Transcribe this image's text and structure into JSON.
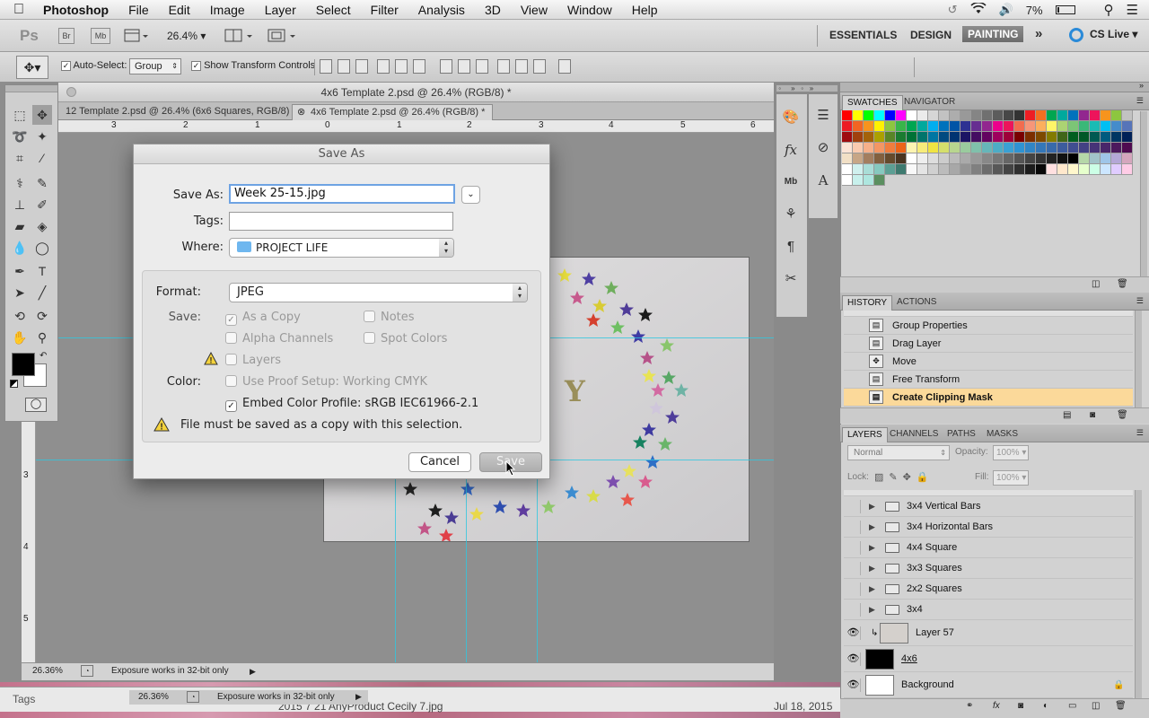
{
  "menubar": {
    "app_name": "Photoshop",
    "items": [
      "File",
      "Edit",
      "Image",
      "Layer",
      "Select",
      "Filter",
      "Analysis",
      "3D",
      "View",
      "Window",
      "Help"
    ],
    "battery": "7%"
  },
  "appbar": {
    "logo": "Ps",
    "bridge": "Br",
    "minibridge": "Mb",
    "zoom": "26.4%",
    "workspaces": [
      "ESSENTIALS",
      "DESIGN",
      "PAINTING"
    ],
    "active_workspace": "PAINTING",
    "more": "»",
    "cslive": "CS Live"
  },
  "options_bar": {
    "auto_select_label": "Auto-Select:",
    "auto_select_checked": true,
    "auto_select_value": "Group",
    "show_transform_label": "Show Transform Controls",
    "show_transform_checked": true
  },
  "document": {
    "window_title": "4x6 Template 2.psd @ 26.4% (RGB/8) *",
    "tabs": [
      {
        "label": "12 Template 2.psd @ 26.4% (6x6 Squares, RGB/8)",
        "active": false
      },
      {
        "label": "4x6 Template 2.psd @ 26.4% (RGB/8) *",
        "active": true
      }
    ],
    "ruler_top": [
      "3",
      "2",
      "1",
      "0",
      "1",
      "2",
      "3",
      "4",
      "5",
      "6"
    ],
    "ruler_left": [
      "3",
      "4",
      "5"
    ],
    "canvas_letter": "Y",
    "status_zoom": "26.36%",
    "status_text": "Exposure works in 32-bit only"
  },
  "background_window": {
    "status_zoom": "26.36%",
    "status_text": "Exposure works in 32-bit only",
    "finder_label": "Tags",
    "finder_file": "2015 7 21 AnyProduct Cecily 7.jpg",
    "finder_date": "Jul 18, 2015"
  },
  "save_dialog": {
    "title": "Save As",
    "save_as_label": "Save As:",
    "filename": "Week 25-15.jpg",
    "tags_label": "Tags:",
    "tags_value": "",
    "where_label": "Where:",
    "where_value": "PROJECT LIFE",
    "format_label": "Format:",
    "format_value": "JPEG",
    "save_label": "Save:",
    "color_label": "Color:",
    "options": {
      "as_a_copy": {
        "label": "As a Copy",
        "checked": true,
        "enabled": false
      },
      "notes": {
        "label": "Notes",
        "checked": false,
        "enabled": false
      },
      "alpha_channels": {
        "label": "Alpha Channels",
        "checked": false,
        "enabled": false
      },
      "spot_colors": {
        "label": "Spot Colors",
        "checked": false,
        "enabled": false
      },
      "layers": {
        "label": "Layers",
        "checked": false,
        "enabled": false
      },
      "use_proof_setup": {
        "label": "Use Proof Setup:  Working CMYK",
        "checked": false,
        "enabled": false
      },
      "embed_color_profile": {
        "label": "Embed Color Profile:  sRGB IEC61966-2.1",
        "checked": true,
        "enabled": true
      }
    },
    "warning": "File must be saved as a copy with this selection.",
    "cancel_label": "Cancel",
    "save_button_label": "Save"
  },
  "swatches_panel": {
    "tabs": [
      "SWATCHES",
      "NAVIGATOR"
    ],
    "active_tab": "SWATCHES"
  },
  "history_panel": {
    "tabs": [
      "HISTORY",
      "ACTIONS"
    ],
    "active_tab": "HISTORY",
    "items": [
      {
        "label": "Group Properties",
        "selected": false
      },
      {
        "label": "Drag Layer",
        "selected": false
      },
      {
        "label": "Move",
        "selected": false
      },
      {
        "label": "Free Transform",
        "selected": false
      },
      {
        "label": "Create Clipping Mask",
        "selected": true
      }
    ]
  },
  "layers_panel": {
    "tabs": [
      "LAYERS",
      "CHANNELS",
      "PATHS",
      "MASKS"
    ],
    "active_tab": "LAYERS",
    "blend_mode": "Normal",
    "opacity_label": "Opacity:",
    "opacity_value": "100%",
    "lock_label": "Lock:",
    "fill_label": "Fill:",
    "fill_value": "100%",
    "layers": [
      {
        "name": "3x4 Vertical Bars",
        "type": "group",
        "visible": false
      },
      {
        "name": "3x4 Horizontal Bars",
        "type": "group",
        "visible": false
      },
      {
        "name": "4x4 Square",
        "type": "group",
        "visible": false
      },
      {
        "name": "3x3 Squares",
        "type": "group",
        "visible": false
      },
      {
        "name": "2x2 Squares",
        "type": "group",
        "visible": false
      },
      {
        "name": "3x4",
        "type": "group",
        "visible": false
      },
      {
        "name": "Layer 57",
        "type": "image",
        "visible": true
      },
      {
        "name": "4x6",
        "type": "shape",
        "visible": true
      },
      {
        "name": "Background",
        "type": "background",
        "visible": true
      }
    ]
  },
  "colors": {
    "guide": "#2ec7e0",
    "history_selected": "#fbd99a",
    "folder_blue": "#6fb7ef",
    "foreground": "#000000",
    "background": "#ffffff"
  }
}
